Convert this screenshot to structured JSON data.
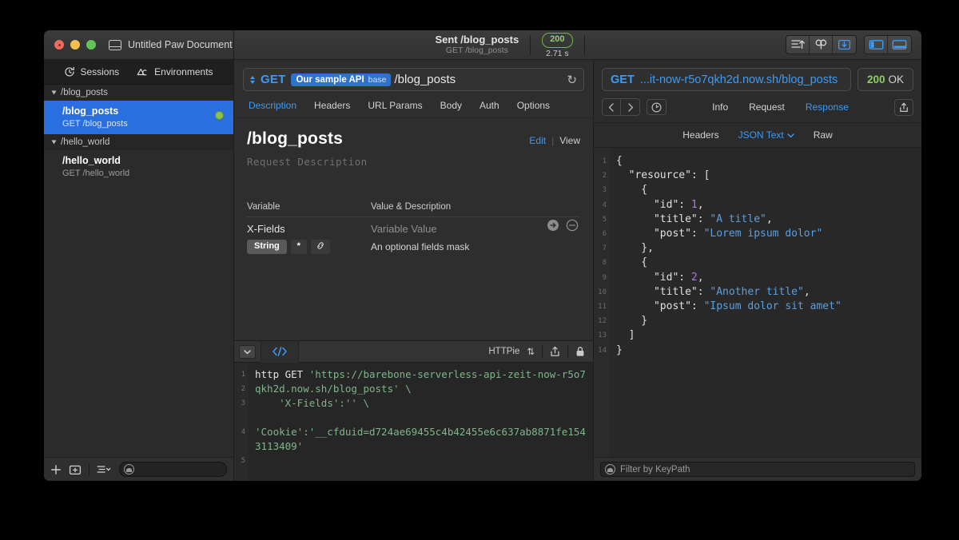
{
  "window": {
    "document_title": "Untitled Paw Document",
    "sent_title": "Sent /blog_posts",
    "sent_subtitle": "GET /blog_posts",
    "status_code": "200",
    "status_time": "2.71 s",
    "accent_blue": "#3d9bf5",
    "selection_blue": "#2a6fe0",
    "status_green": "#8ccf63"
  },
  "sidebar": {
    "tabs": [
      {
        "label": "Sessions",
        "icon": "history-clock-icon"
      },
      {
        "label": "Environments",
        "icon": "environments-icon"
      }
    ],
    "groups": [
      {
        "label": "/blog_posts",
        "items": [
          {
            "name": "/blog_posts",
            "sub": "GET /blog_posts",
            "selected": true,
            "status_dot": "#8bc34a"
          }
        ]
      },
      {
        "label": "/hello_world",
        "items": [
          {
            "name": "/hello_world",
            "sub": "GET /hello_world",
            "selected": false
          }
        ]
      }
    ],
    "bottom": {
      "add_icon": "plus-icon",
      "new_group_icon": "new-folder-icon",
      "list_menu_icon": "list-menu-icon",
      "search_placeholder": ""
    }
  },
  "request": {
    "method": "GET",
    "env_token": "Our sample API",
    "env_token_suffix": "base",
    "path": "/blog_posts",
    "reload_icon": "reload-icon",
    "tabs": [
      {
        "label": "Description",
        "active": true
      },
      {
        "label": "Headers",
        "active": false
      },
      {
        "label": "URL Params",
        "active": false
      },
      {
        "label": "Body",
        "active": false
      },
      {
        "label": "Auth",
        "active": false
      },
      {
        "label": "Options",
        "active": false
      }
    ],
    "description": {
      "title": "/blog_posts",
      "placeholder": "Request Description",
      "edit_label": "Edit",
      "view_label": "View",
      "columns": [
        "Variable",
        "Value & Description"
      ],
      "rows": [
        {
          "variable": "X-Fields",
          "type_badge": "String",
          "required_badge": "*",
          "link_icon": "link-icon",
          "value_placeholder": "Variable Value",
          "description": "An optional fields mask"
        }
      ]
    }
  },
  "code_panel": {
    "tab_icon": "code-brackets-icon",
    "language": "HTTPie",
    "share_icon": "share-icon",
    "lock_icon": "lock-icon",
    "line_numbers": [
      "1",
      "2",
      "3",
      "4",
      "5"
    ],
    "command_prefix": "http GET ",
    "code": "'https://barebone-serverless-api-zeit-now-r5o7qkh2d.now.sh/blog_posts' \\\n    'X-Fields':'' \\\n\n'Cookie':'__cfduid=d724ae69455c4b42455e6c637ab8871fe1543113409'"
  },
  "response": {
    "method": "GET",
    "url": "...it-now-r5o7qkh2d.now.sh/blog_posts",
    "status_code": "200",
    "status_text": "OK",
    "back_icon": "chevron-left-icon",
    "forward_icon": "chevron-right-icon",
    "history_icon": "history-clock-icon",
    "share_icon": "share-icon",
    "tabs": [
      {
        "label": "Info",
        "active": false
      },
      {
        "label": "Request",
        "active": false
      },
      {
        "label": "Response",
        "active": true
      }
    ],
    "sub_tabs": [
      {
        "label": "Headers",
        "active": false
      },
      {
        "label": "JSON Text",
        "active": true,
        "has_chevron": true
      },
      {
        "label": "Raw",
        "active": false
      }
    ],
    "line_numbers": [
      "1",
      "2",
      "3",
      "4",
      "5",
      "6",
      "7",
      "8",
      "9",
      "10",
      "11",
      "12",
      "13",
      "14"
    ],
    "body": "{\n  \"resource\": [\n    {\n      \"id\": 1,\n      \"title\": \"A title\",\n      \"post\": \"Lorem ipsum dolor\"\n    },\n    {\n      \"id\": 2,\n      \"title\": \"Another title\",\n      \"post\": \"Ipsum dolor sit amet\"\n    }\n  ]\n}",
    "filter_placeholder": "Filter by KeyPath"
  },
  "toolbar": {
    "send_icon": "send-request-icon",
    "cookies_icon": "cookies-icon",
    "import_icon": "import-icon",
    "left_panel_icon": "toggle-left-panel-icon",
    "bottom_panel_icon": "toggle-bottom-panel-icon"
  }
}
